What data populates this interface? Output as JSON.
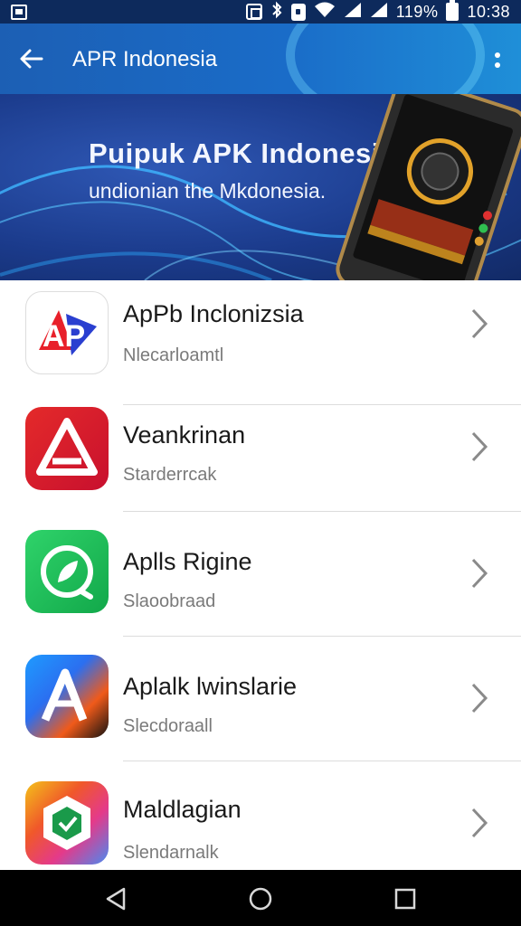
{
  "status_bar": {
    "battery_text": "119%",
    "time": "10:38"
  },
  "app_bar": {
    "title": "APR Indonesia",
    "back_icon": "arrow-back-icon",
    "more_icon": "more-vert-icon"
  },
  "banner": {
    "title": "Puipuk APK Indonesia",
    "subtitle": "undionian the Mkdonesia."
  },
  "list": {
    "items": [
      {
        "title": "ApPb Inclonizsia",
        "subtitle": "Nlecarloamtl",
        "icon": "apk-logo-icon"
      },
      {
        "title": "Veankrinan",
        "subtitle": "Starderrcak",
        "icon": "triangle-logo-icon"
      },
      {
        "title": "Aplls Rigine",
        "subtitle": "Slaoobraad",
        "icon": "leaf-circle-icon"
      },
      {
        "title": "Aplalk lwinslarie",
        "subtitle": "Slecdoraall",
        "icon": "a-letter-logo-icon"
      },
      {
        "title": "Maldlagian",
        "subtitle": "Slendarnalk",
        "icon": "hexagon-shield-icon"
      }
    ]
  },
  "colors": {
    "app_bar": "#1c5fb4",
    "status_bar": "#0d2a5c",
    "banner": "#1b3b8c",
    "nav_bar": "#000000"
  }
}
